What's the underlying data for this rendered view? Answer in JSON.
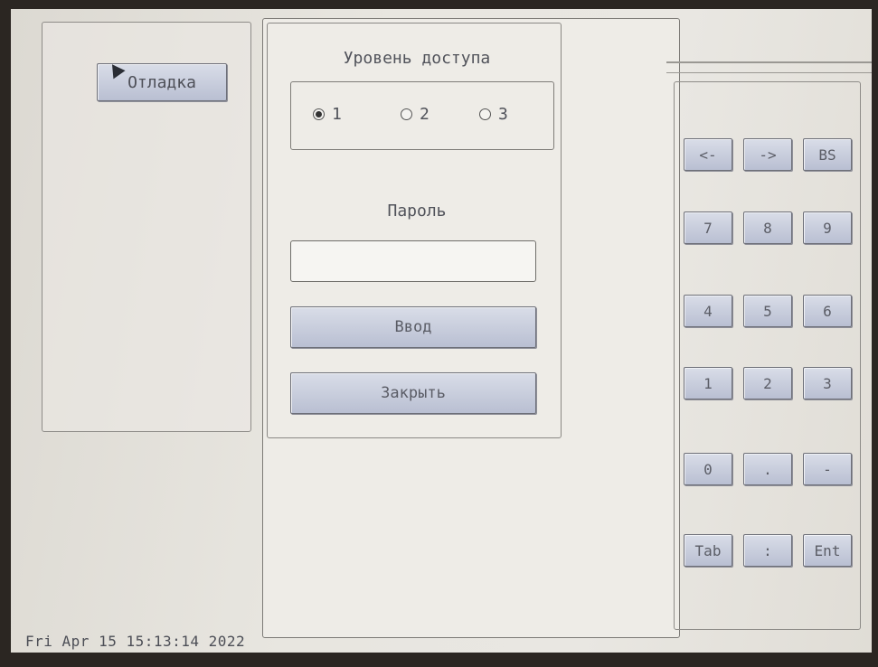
{
  "left_panel": {
    "debug_button": "Отладка"
  },
  "dialog": {
    "access_level_title": "Уровень доступа",
    "access_levels": [
      {
        "label": "1",
        "selected": true
      },
      {
        "label": "2",
        "selected": false
      },
      {
        "label": "3",
        "selected": false
      }
    ],
    "password_label": "Пароль",
    "password_value": "",
    "enter_button": "Ввод",
    "close_button": "Закрыть"
  },
  "keypad": {
    "row1": [
      "<-",
      "->",
      "BS"
    ],
    "row2": [
      "7",
      "8",
      "9"
    ],
    "row3": [
      "4",
      "5",
      "6"
    ],
    "row4": [
      "1",
      "2",
      "3"
    ],
    "row5": [
      "0",
      ".",
      "-"
    ],
    "row6": [
      "Tab",
      ":",
      "Ent"
    ]
  },
  "status_bar": {
    "datetime": "Fri Apr 15 15:13:14 2022"
  },
  "colors": {
    "screen_bg": "#e8e6e0",
    "button_bg": "#c4c9d9",
    "border": "#8e8c88"
  },
  "icons": {
    "pointer": "mouse-pointer-icon"
  }
}
